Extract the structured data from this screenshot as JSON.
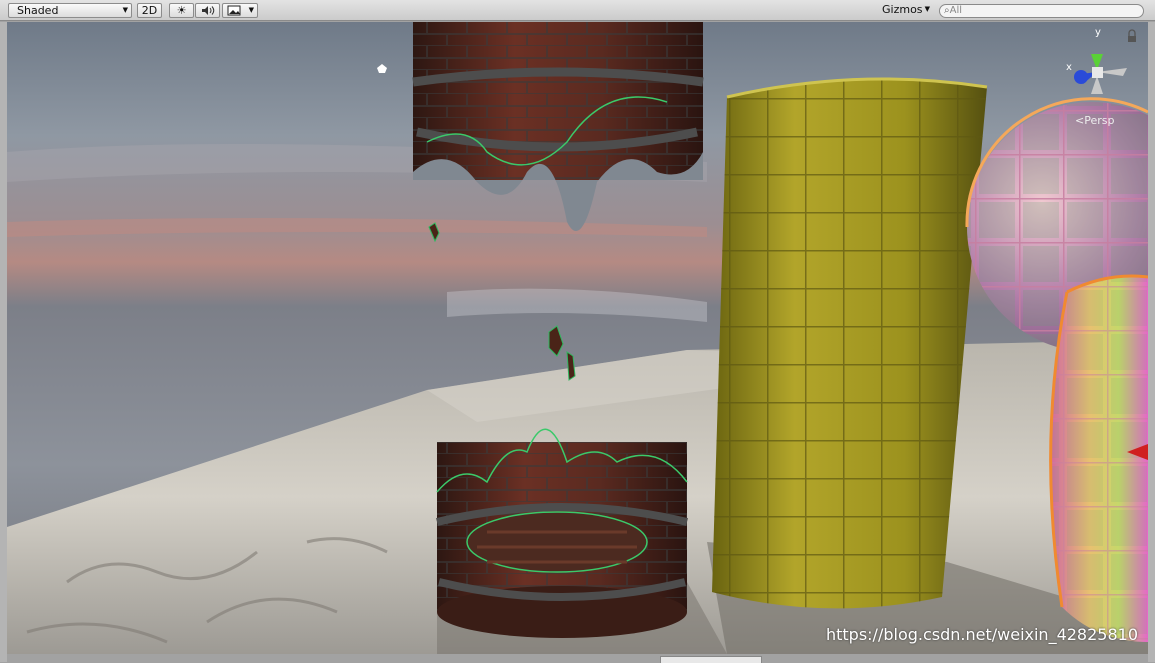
{
  "toolbar": {
    "shading_mode": "Shaded",
    "mode_2d": "2D",
    "lighting_icon": "sun-icon",
    "audio_icon": "speaker-icon",
    "effects_icon": "image-icon",
    "gizmos_label": "Gizmos",
    "search_placeholder": "All"
  },
  "gizmo": {
    "y_label": "y",
    "x_label": "x",
    "projection_label": "Persp"
  },
  "watermark": "https://blog.csdn.net/weixin_42825810"
}
